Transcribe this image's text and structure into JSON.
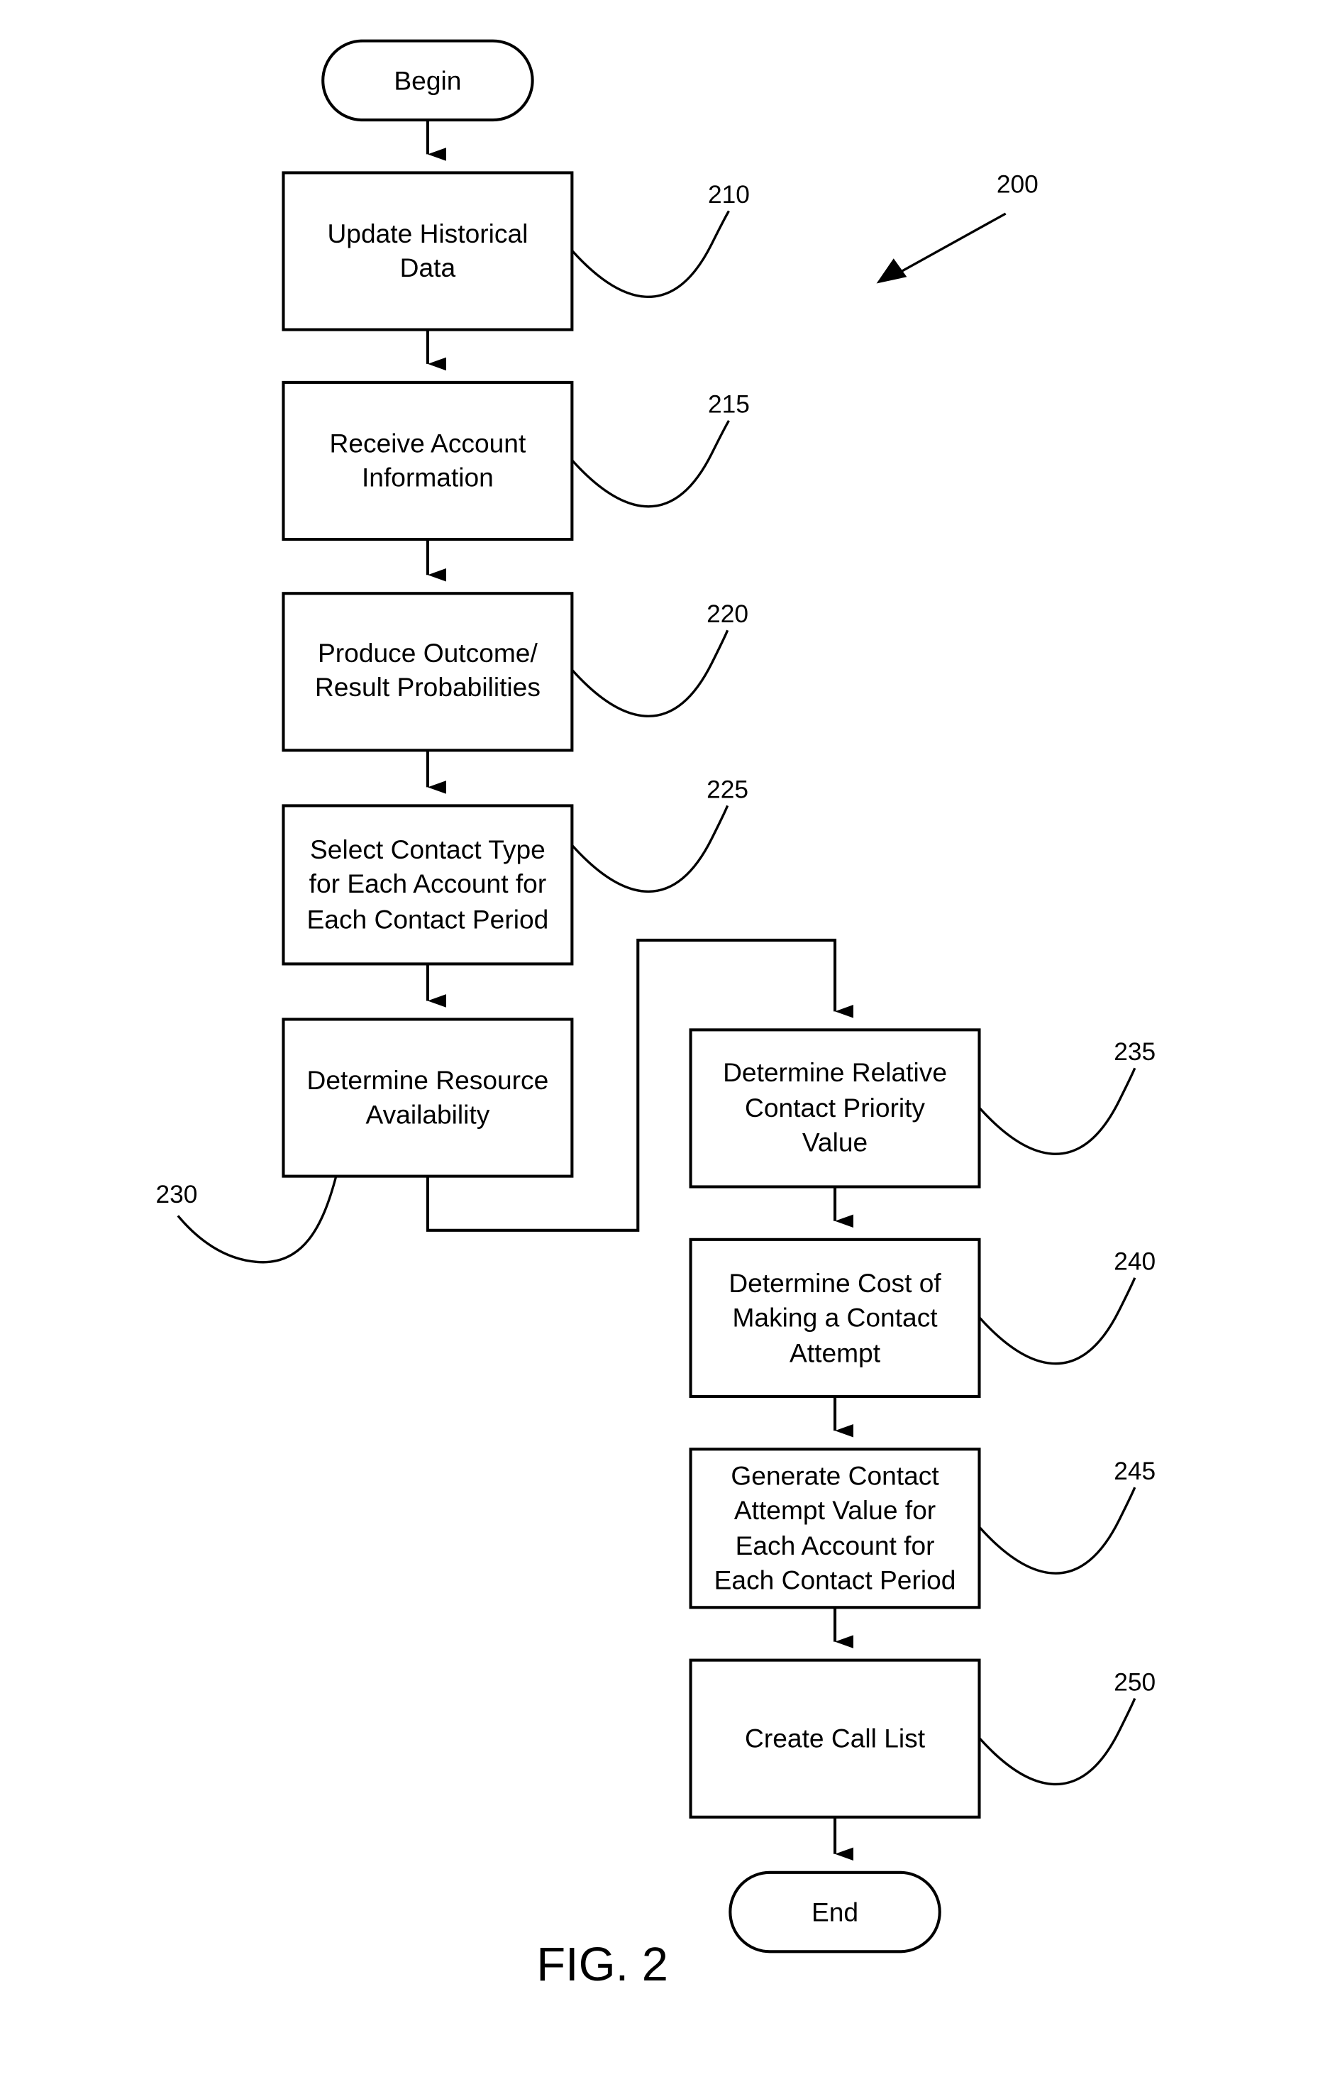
{
  "figure_label": "FIG. 2",
  "diagram_ref": "200",
  "terminals": {
    "begin": "Begin",
    "end": "End"
  },
  "steps": [
    {
      "ref": "210",
      "lines": [
        "Update Historical",
        "Data"
      ]
    },
    {
      "ref": "215",
      "lines": [
        "Receive Account",
        "Information"
      ]
    },
    {
      "ref": "220",
      "lines": [
        "Produce Outcome/",
        "Result Probabilities"
      ]
    },
    {
      "ref": "225",
      "lines": [
        "Select Contact Type",
        "for Each Account for",
        "Each Contact Period"
      ]
    },
    {
      "ref": "230",
      "lines": [
        "Determine Resource",
        "Availability"
      ]
    },
    {
      "ref": "235",
      "lines": [
        "Determine Relative",
        "Contact Priority",
        "Value"
      ]
    },
    {
      "ref": "240",
      "lines": [
        "Determine Cost of",
        "Making a Contact",
        "Attempt"
      ]
    },
    {
      "ref": "245",
      "lines": [
        "Generate Contact",
        "Attempt Value for",
        "Each Account for",
        "Each Contact Period"
      ]
    },
    {
      "ref": "250",
      "lines": [
        "Create Call List"
      ]
    }
  ]
}
